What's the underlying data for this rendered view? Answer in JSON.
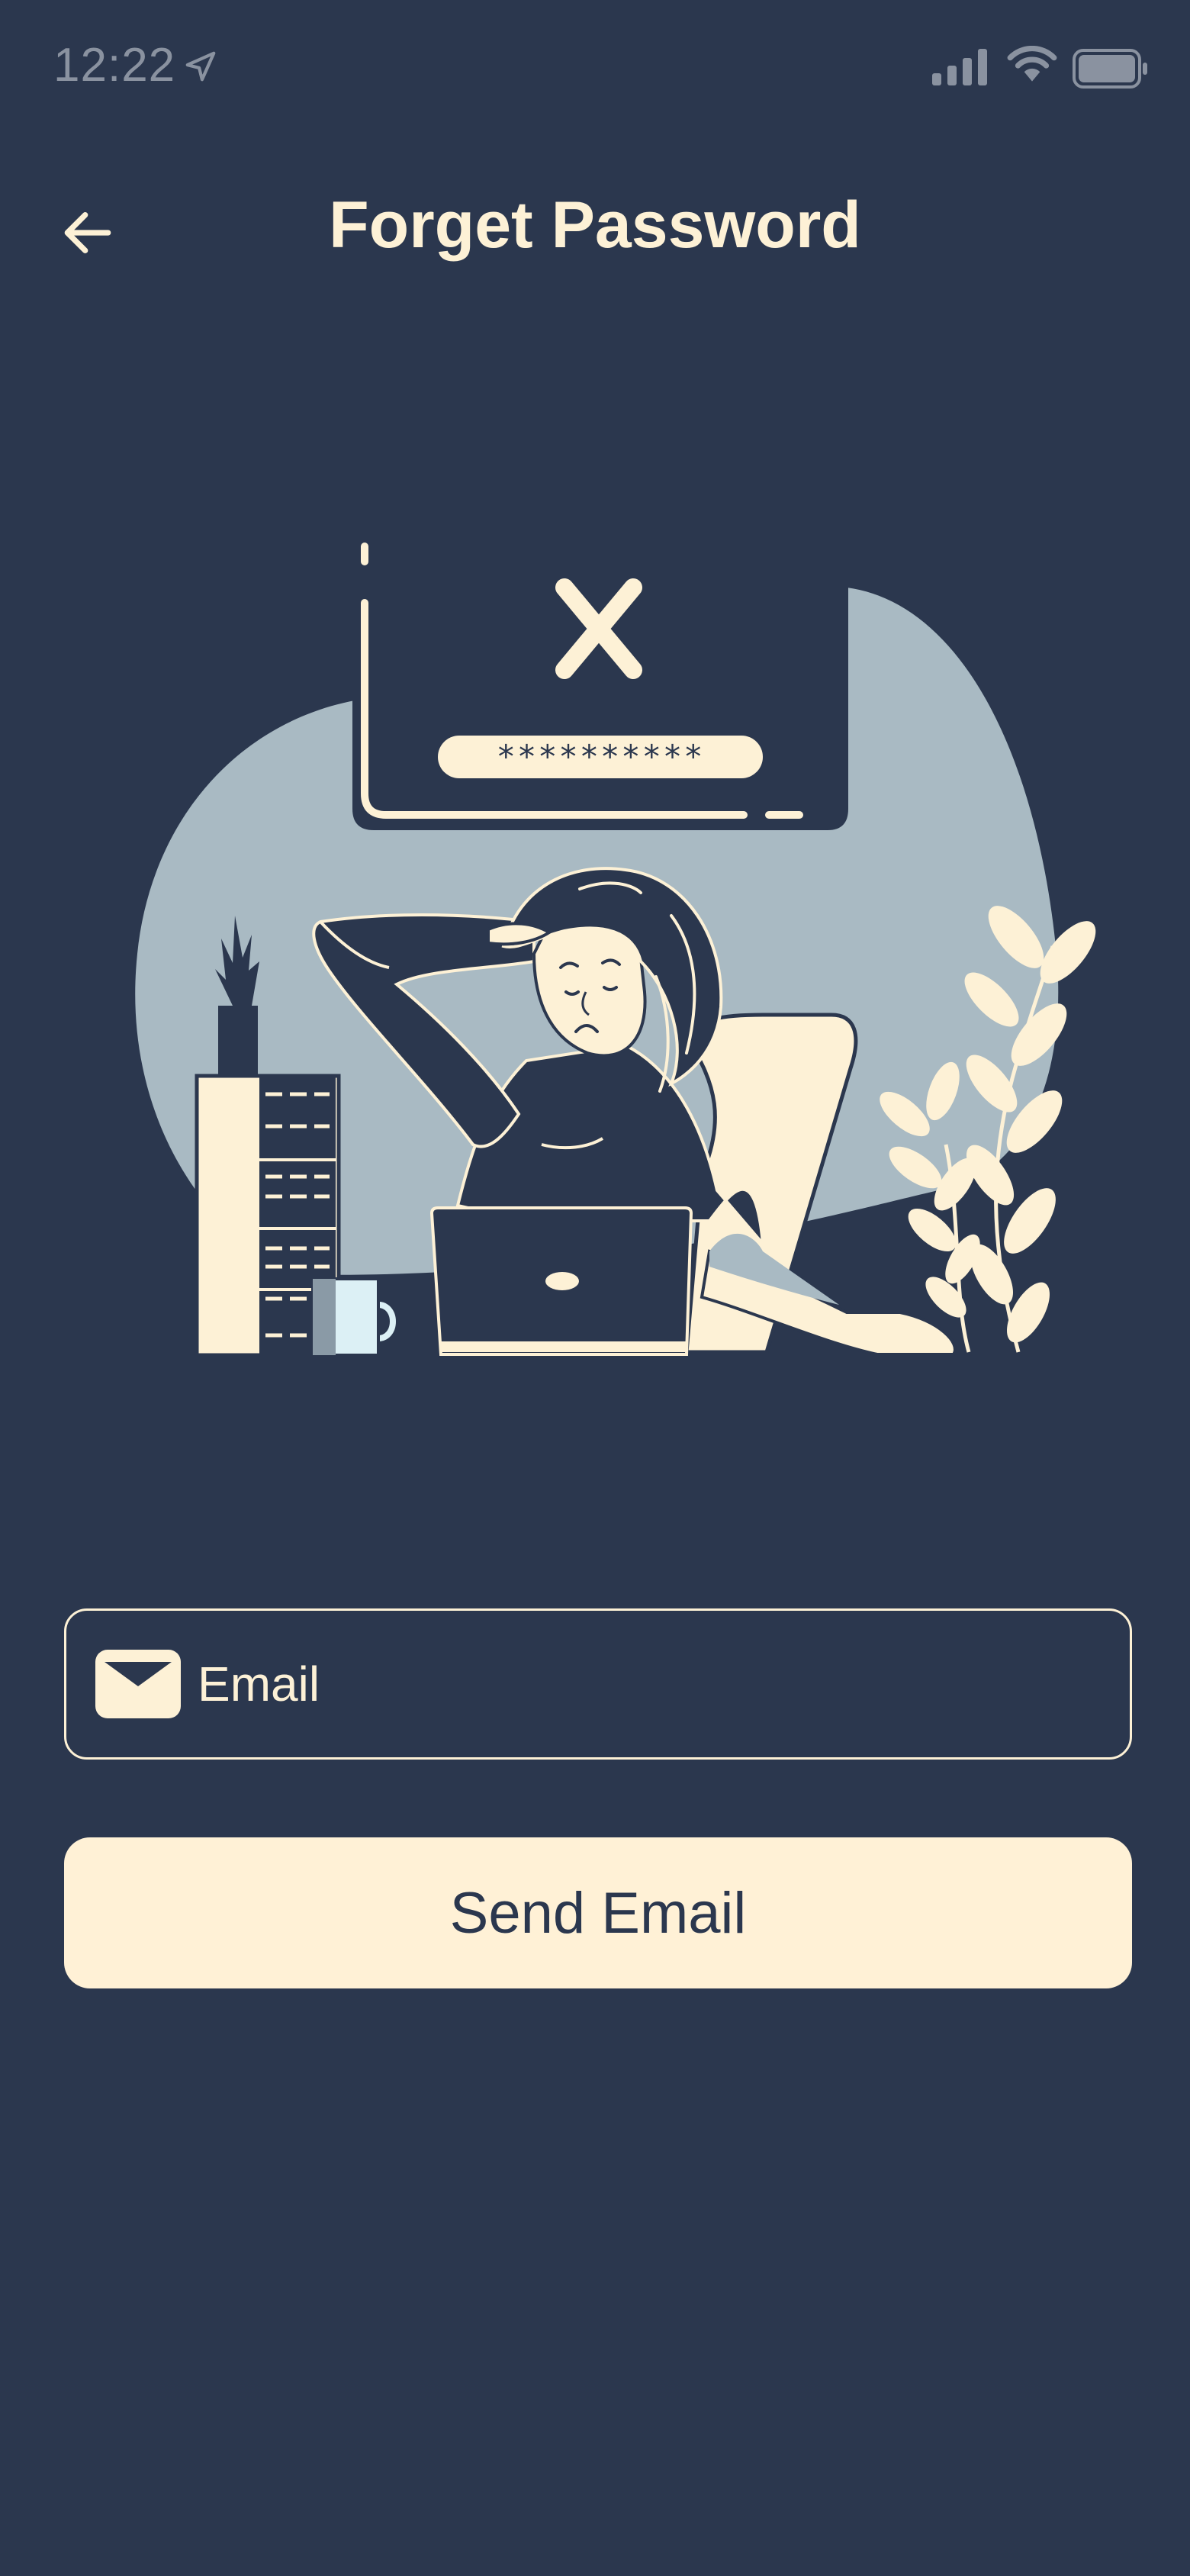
{
  "status_bar": {
    "time": "12:22",
    "icons": [
      "location-arrow-icon",
      "cell-signal-icon",
      "wifi-icon",
      "battery-icon"
    ]
  },
  "header": {
    "back_icon": "arrow-left-icon",
    "title": "Forget Password"
  },
  "illustration": {
    "password_mask": "**********",
    "error_symbol": "X"
  },
  "form": {
    "email_icon": "envelope-icon",
    "email_placeholder": "Email",
    "email_value": "",
    "send_label": "Send Email"
  },
  "colors": {
    "background": "#2b374e",
    "cream": "#fff1d6",
    "blob": "#a9bac3",
    "muted": "#8a92a0"
  }
}
